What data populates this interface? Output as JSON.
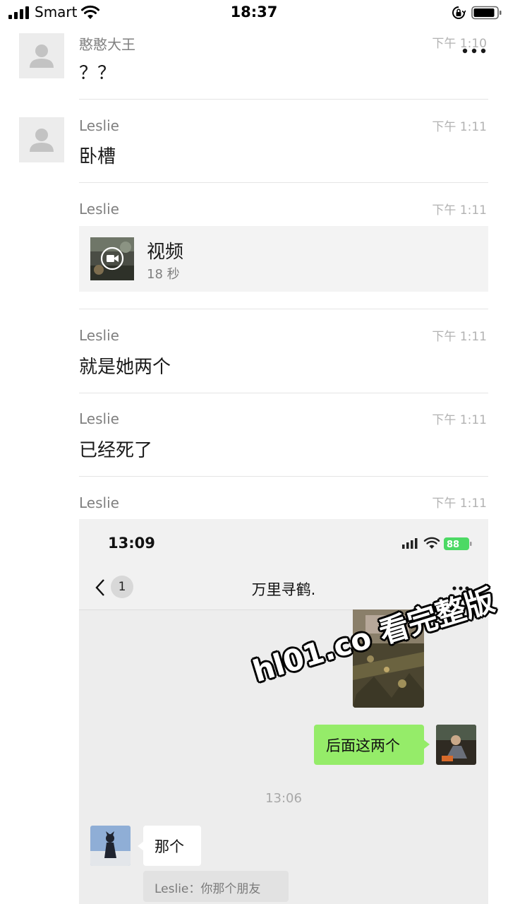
{
  "status_bar": {
    "carrier": "Smart",
    "time": "18:37"
  },
  "messages": [
    {
      "sender": "憨憨大王",
      "time": "下午 1:10",
      "text": "？？"
    },
    {
      "sender": "Leslie",
      "time": "下午 1:11",
      "text": "卧槽"
    },
    {
      "sender": "Leslie",
      "time": "下午 1:11",
      "video": {
        "title": "视频",
        "duration": "18 秒"
      }
    },
    {
      "sender": "Leslie",
      "time": "下午 1:11",
      "text": "就是她两个"
    },
    {
      "sender": "Leslie",
      "time": "下午 1:11",
      "text": "已经死了"
    },
    {
      "sender": "Leslie",
      "time": "下午 1:11"
    }
  ],
  "screenshot": {
    "time": "13:09",
    "battery": "88",
    "unread_badge": "1",
    "chat_title": "万里寻鹤.",
    "green_message": "后面这两个",
    "timestamp": "13:06",
    "white_message": "那个",
    "quote": "Leslie：你那个朋友"
  },
  "watermark": "hl01.co 看完整版"
}
